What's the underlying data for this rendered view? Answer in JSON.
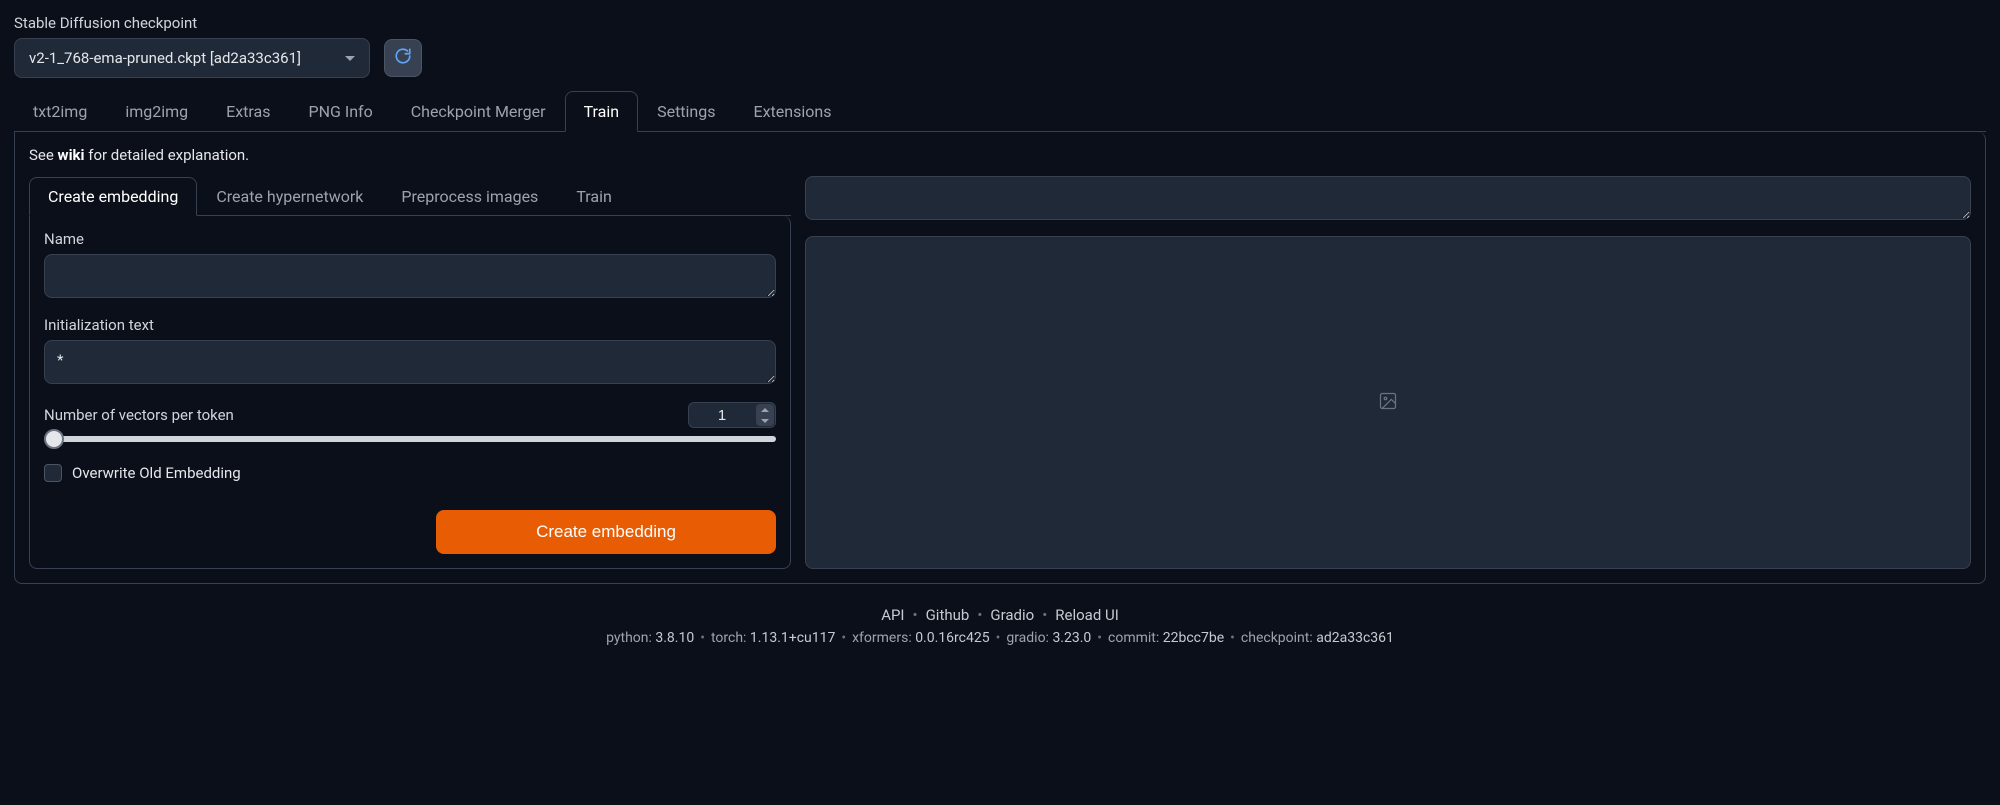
{
  "checkpoint": {
    "label": "Stable Diffusion checkpoint",
    "value": "v2-1_768-ema-pruned.ckpt [ad2a33c361]"
  },
  "main_tabs": {
    "items": [
      "txt2img",
      "img2img",
      "Extras",
      "PNG Info",
      "Checkpoint Merger",
      "Train",
      "Settings",
      "Extensions"
    ],
    "active": "Train"
  },
  "info": {
    "prefix": "See ",
    "wiki": "wiki",
    "suffix": " for detailed explanation."
  },
  "sub_tabs": {
    "items": [
      "Create embedding",
      "Create hypernetwork",
      "Preprocess images",
      "Train"
    ],
    "active": "Create embedding"
  },
  "form": {
    "name_label": "Name",
    "name_value": "",
    "init_label": "Initialization text",
    "init_value": "*",
    "vectors_label": "Number of vectors per token",
    "vectors_value": "1",
    "overwrite_label": "Overwrite Old Embedding",
    "create_button": "Create embedding"
  },
  "footer": {
    "links": [
      "API",
      "Github",
      "Gradio",
      "Reload UI"
    ],
    "meta": [
      {
        "label": "python",
        "value": "3.8.10"
      },
      {
        "label": "torch",
        "value": "1.13.1+cu117"
      },
      {
        "label": "xformers",
        "value": "0.0.16rc425"
      },
      {
        "label": "gradio",
        "value": "3.23.0"
      },
      {
        "label": "commit",
        "value": "22bcc7be"
      },
      {
        "label": "checkpoint",
        "value": "ad2a33c361"
      }
    ]
  }
}
